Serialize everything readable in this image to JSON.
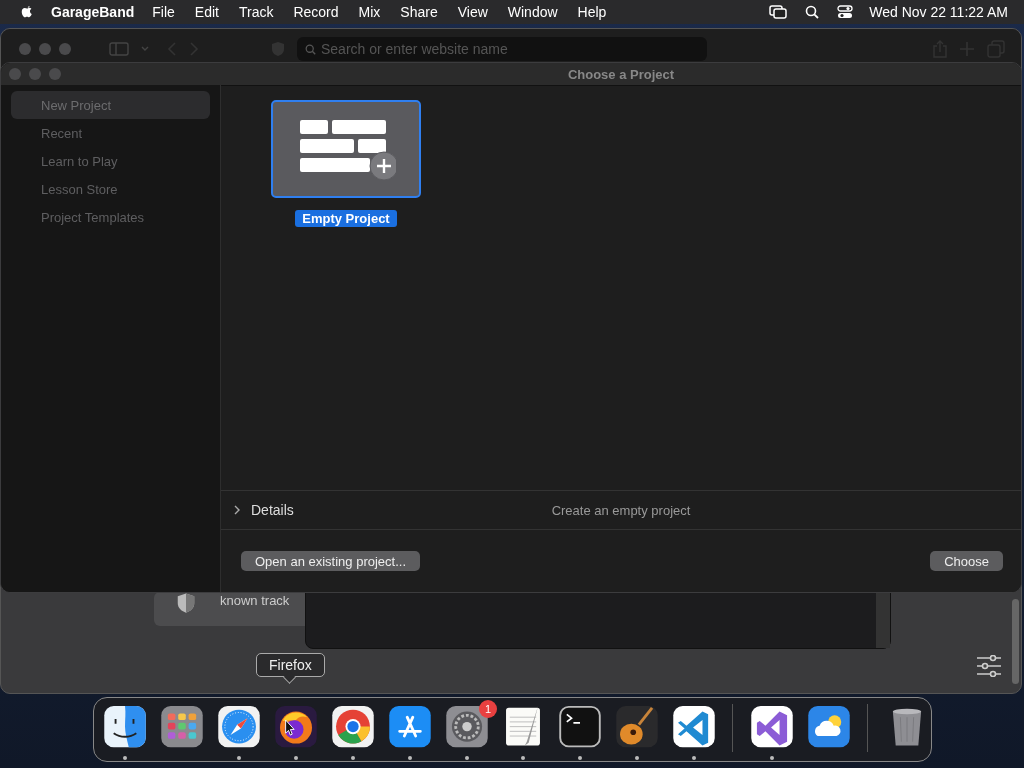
{
  "menu_bar": {
    "app_name": "GarageBand",
    "menus": [
      "File",
      "Edit",
      "Track",
      "Record",
      "Mix",
      "Share",
      "View",
      "Window",
      "Help"
    ],
    "clock": "Wed Nov 22  11:22 AM"
  },
  "browser": {
    "search_placeholder": "Search or enter website name",
    "partial_text": "known track"
  },
  "dialog": {
    "title": "Choose a Project",
    "sidebar": [
      {
        "label": "New Project",
        "selected": true
      },
      {
        "label": "Recent",
        "selected": false
      },
      {
        "label": "Learn to Play",
        "selected": false
      },
      {
        "label": "Lesson Store",
        "selected": false
      },
      {
        "label": "Project Templates",
        "selected": false
      }
    ],
    "projects": [
      {
        "label": "Empty Project",
        "selected": true
      }
    ],
    "details": {
      "label": "Details",
      "expanded": false,
      "description": "Create an empty project"
    },
    "buttons": {
      "open": "Open an existing project...",
      "choose": "Choose"
    }
  },
  "tooltip": "Firefox",
  "dock": [
    {
      "kind": "finder",
      "running": true
    },
    {
      "kind": "launchpad",
      "running": false
    },
    {
      "kind": "safari",
      "running": true
    },
    {
      "kind": "firefox",
      "running": true
    },
    {
      "kind": "chrome",
      "running": true
    },
    {
      "kind": "appstore",
      "running": true
    },
    {
      "kind": "settings",
      "running": true,
      "badge": "1"
    },
    {
      "kind": "textedit",
      "running": true
    },
    {
      "kind": "terminal",
      "running": true
    },
    {
      "kind": "guitar",
      "running": true
    },
    {
      "kind": "vscode",
      "running": true
    },
    {
      "kind": "separator"
    },
    {
      "kind": "vstudio",
      "running": true
    },
    {
      "kind": "weather",
      "running": false
    },
    {
      "kind": "separator"
    },
    {
      "kind": "trash",
      "running": false
    }
  ]
}
